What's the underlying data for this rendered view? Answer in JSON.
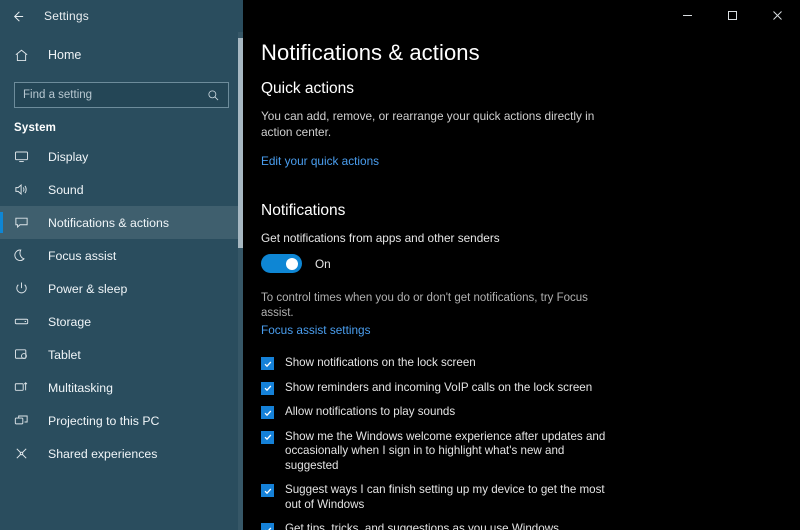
{
  "titlebar": {
    "app_title": "Settings",
    "back_icon": "back-arrow-icon",
    "minimize_label": "–",
    "maximize_label": "□",
    "close_label": "✕"
  },
  "sidebar": {
    "home": {
      "label": "Home",
      "icon": "home-icon"
    },
    "search": {
      "placeholder": "Find a setting",
      "value": "",
      "icon": "search-icon"
    },
    "group_title": "System",
    "items": [
      {
        "label": "Display",
        "icon": "monitor-icon",
        "selected": false
      },
      {
        "label": "Sound",
        "icon": "speaker-icon",
        "selected": false
      },
      {
        "label": "Notifications & actions",
        "icon": "notification-icon",
        "selected": true
      },
      {
        "label": "Focus assist",
        "icon": "moon-icon",
        "selected": false
      },
      {
        "label": "Power & sleep",
        "icon": "power-icon",
        "selected": false
      },
      {
        "label": "Storage",
        "icon": "storage-icon",
        "selected": false
      },
      {
        "label": "Tablet",
        "icon": "tablet-icon",
        "selected": false
      },
      {
        "label": "Multitasking",
        "icon": "multitasking-icon",
        "selected": false
      },
      {
        "label": "Projecting to this PC",
        "icon": "projecting-icon",
        "selected": false
      },
      {
        "label": "Shared experiences",
        "icon": "shared-experiences-icon",
        "selected": false
      }
    ]
  },
  "main": {
    "page_title": "Notifications & actions",
    "quick_actions": {
      "heading": "Quick actions",
      "description": "You can add, remove, or rearrange your quick actions directly in action center.",
      "link": "Edit your quick actions"
    },
    "notifications": {
      "heading": "Notifications",
      "toggle_label": "Get notifications from apps and other senders",
      "toggle_state": "On",
      "toggle_on": true,
      "hint": "To control times when you do or don't get notifications, try Focus assist.",
      "hint_link": "Focus assist settings",
      "checkboxes": [
        {
          "label": "Show notifications on the lock screen",
          "checked": true
        },
        {
          "label": "Show reminders and incoming VoIP calls on the lock screen",
          "checked": true
        },
        {
          "label": "Allow notifications to play sounds",
          "checked": true
        },
        {
          "label": "Show me the Windows welcome experience after updates and occasionally when I sign in to highlight what's new and suggested",
          "checked": true
        },
        {
          "label": "Suggest ways I can finish setting up my device to get the most out of Windows",
          "checked": true
        },
        {
          "label": "Get tips, tricks, and suggestions as you use Windows",
          "checked": true
        }
      ]
    }
  },
  "colors": {
    "sidebar_bg": "#2a4d5e",
    "content_bg": "#000000",
    "accent": "#0e86d4",
    "link": "#4a9eef",
    "checkbox": "#1581d8"
  }
}
